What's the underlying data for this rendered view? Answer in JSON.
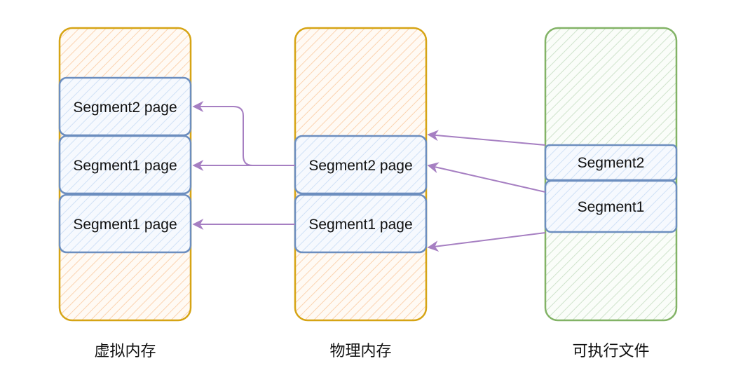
{
  "columns": {
    "virtual": {
      "caption": "虚拟内存",
      "blocks": [
        "Segment2 page",
        "Segment1 page",
        "Segment1 page"
      ]
    },
    "physical": {
      "caption": "物理内存",
      "blocks": [
        "Segment2 page",
        "Segment1 page"
      ]
    },
    "executable": {
      "caption": "可执行文件",
      "blocks": [
        "Segment2",
        "Segment1"
      ]
    }
  },
  "colors": {
    "memory_border": "#d6a414",
    "memory_fill": "#fde4cc",
    "file_border": "#82b366",
    "file_fill": "#d5e8d4",
    "block_border": "#6c8ebf",
    "block_fill": "#dae8fc",
    "arrow": "#a67fc2"
  }
}
